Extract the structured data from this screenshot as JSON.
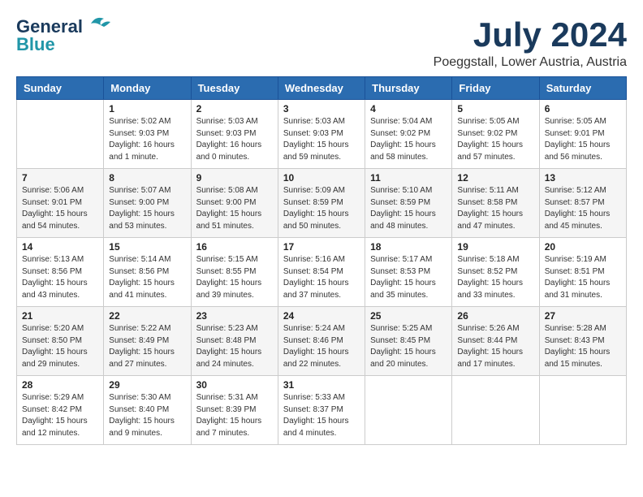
{
  "logo": {
    "line1": "General",
    "line2": "Blue"
  },
  "title": "July 2024",
  "location": "Poeggstall, Lower Austria, Austria",
  "weekdays": [
    "Sunday",
    "Monday",
    "Tuesday",
    "Wednesday",
    "Thursday",
    "Friday",
    "Saturday"
  ],
  "weeks": [
    [
      {
        "day": "",
        "content": ""
      },
      {
        "day": "1",
        "content": "Sunrise: 5:02 AM\nSunset: 9:03 PM\nDaylight: 16 hours\nand 1 minute."
      },
      {
        "day": "2",
        "content": "Sunrise: 5:03 AM\nSunset: 9:03 PM\nDaylight: 16 hours\nand 0 minutes."
      },
      {
        "day": "3",
        "content": "Sunrise: 5:03 AM\nSunset: 9:03 PM\nDaylight: 15 hours\nand 59 minutes."
      },
      {
        "day": "4",
        "content": "Sunrise: 5:04 AM\nSunset: 9:02 PM\nDaylight: 15 hours\nand 58 minutes."
      },
      {
        "day": "5",
        "content": "Sunrise: 5:05 AM\nSunset: 9:02 PM\nDaylight: 15 hours\nand 57 minutes."
      },
      {
        "day": "6",
        "content": "Sunrise: 5:05 AM\nSunset: 9:01 PM\nDaylight: 15 hours\nand 56 minutes."
      }
    ],
    [
      {
        "day": "7",
        "content": "Sunrise: 5:06 AM\nSunset: 9:01 PM\nDaylight: 15 hours\nand 54 minutes."
      },
      {
        "day": "8",
        "content": "Sunrise: 5:07 AM\nSunset: 9:00 PM\nDaylight: 15 hours\nand 53 minutes."
      },
      {
        "day": "9",
        "content": "Sunrise: 5:08 AM\nSunset: 9:00 PM\nDaylight: 15 hours\nand 51 minutes."
      },
      {
        "day": "10",
        "content": "Sunrise: 5:09 AM\nSunset: 8:59 PM\nDaylight: 15 hours\nand 50 minutes."
      },
      {
        "day": "11",
        "content": "Sunrise: 5:10 AM\nSunset: 8:59 PM\nDaylight: 15 hours\nand 48 minutes."
      },
      {
        "day": "12",
        "content": "Sunrise: 5:11 AM\nSunset: 8:58 PM\nDaylight: 15 hours\nand 47 minutes."
      },
      {
        "day": "13",
        "content": "Sunrise: 5:12 AM\nSunset: 8:57 PM\nDaylight: 15 hours\nand 45 minutes."
      }
    ],
    [
      {
        "day": "14",
        "content": "Sunrise: 5:13 AM\nSunset: 8:56 PM\nDaylight: 15 hours\nand 43 minutes."
      },
      {
        "day": "15",
        "content": "Sunrise: 5:14 AM\nSunset: 8:56 PM\nDaylight: 15 hours\nand 41 minutes."
      },
      {
        "day": "16",
        "content": "Sunrise: 5:15 AM\nSunset: 8:55 PM\nDaylight: 15 hours\nand 39 minutes."
      },
      {
        "day": "17",
        "content": "Sunrise: 5:16 AM\nSunset: 8:54 PM\nDaylight: 15 hours\nand 37 minutes."
      },
      {
        "day": "18",
        "content": "Sunrise: 5:17 AM\nSunset: 8:53 PM\nDaylight: 15 hours\nand 35 minutes."
      },
      {
        "day": "19",
        "content": "Sunrise: 5:18 AM\nSunset: 8:52 PM\nDaylight: 15 hours\nand 33 minutes."
      },
      {
        "day": "20",
        "content": "Sunrise: 5:19 AM\nSunset: 8:51 PM\nDaylight: 15 hours\nand 31 minutes."
      }
    ],
    [
      {
        "day": "21",
        "content": "Sunrise: 5:20 AM\nSunset: 8:50 PM\nDaylight: 15 hours\nand 29 minutes."
      },
      {
        "day": "22",
        "content": "Sunrise: 5:22 AM\nSunset: 8:49 PM\nDaylight: 15 hours\nand 27 minutes."
      },
      {
        "day": "23",
        "content": "Sunrise: 5:23 AM\nSunset: 8:48 PM\nDaylight: 15 hours\nand 24 minutes."
      },
      {
        "day": "24",
        "content": "Sunrise: 5:24 AM\nSunset: 8:46 PM\nDaylight: 15 hours\nand 22 minutes."
      },
      {
        "day": "25",
        "content": "Sunrise: 5:25 AM\nSunset: 8:45 PM\nDaylight: 15 hours\nand 20 minutes."
      },
      {
        "day": "26",
        "content": "Sunrise: 5:26 AM\nSunset: 8:44 PM\nDaylight: 15 hours\nand 17 minutes."
      },
      {
        "day": "27",
        "content": "Sunrise: 5:28 AM\nSunset: 8:43 PM\nDaylight: 15 hours\nand 15 minutes."
      }
    ],
    [
      {
        "day": "28",
        "content": "Sunrise: 5:29 AM\nSunset: 8:42 PM\nDaylight: 15 hours\nand 12 minutes."
      },
      {
        "day": "29",
        "content": "Sunrise: 5:30 AM\nSunset: 8:40 PM\nDaylight: 15 hours\nand 9 minutes."
      },
      {
        "day": "30",
        "content": "Sunrise: 5:31 AM\nSunset: 8:39 PM\nDaylight: 15 hours\nand 7 minutes."
      },
      {
        "day": "31",
        "content": "Sunrise: 5:33 AM\nSunset: 8:37 PM\nDaylight: 15 hours\nand 4 minutes."
      },
      {
        "day": "",
        "content": ""
      },
      {
        "day": "",
        "content": ""
      },
      {
        "day": "",
        "content": ""
      }
    ]
  ]
}
